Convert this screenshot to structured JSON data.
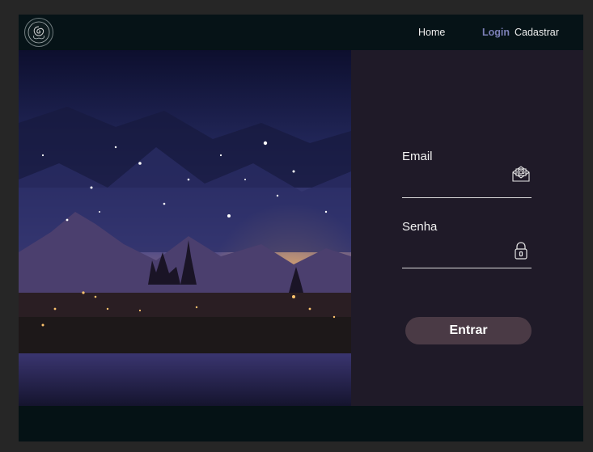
{
  "nav": {
    "home": "Home",
    "login": "Login",
    "register": "Cadastrar"
  },
  "form": {
    "email_label": "Email",
    "password_label": "Senha",
    "submit_label": "Entrar"
  },
  "icons": {
    "logo": "rose-logo-icon",
    "email": "envelope-at-icon",
    "password": "lock-icon"
  },
  "colors": {
    "nav_bg": "#061317",
    "panel_bg": "#1f1a28",
    "active_link": "#7b7fb6",
    "button_bg": "#4a3a45"
  }
}
